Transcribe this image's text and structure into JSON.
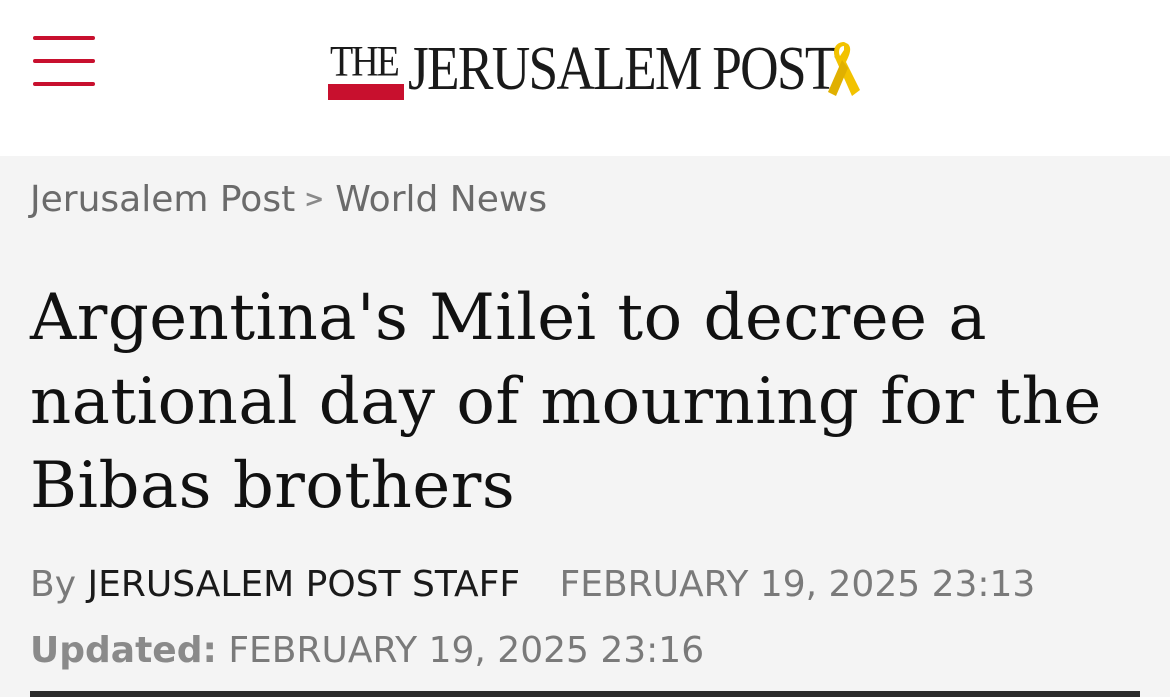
{
  "header": {
    "menu_icon": "hamburger-menu-icon",
    "logo": {
      "the": "THE",
      "name": "JERUSALEM POST",
      "ribbon_icon": "yellow-ribbon-icon"
    },
    "colors": {
      "brand_red": "#c8102e",
      "ribbon_yellow": "#f2c200"
    }
  },
  "breadcrumb": {
    "home": "Jerusalem Post",
    "separator": ">",
    "section": "World News"
  },
  "article": {
    "headline": "Argentina's Milei to decree a national day of mourning for the Bibas brothers",
    "byline_prefix": "By",
    "author": "JERUSALEM POST STAFF",
    "published": "FEBRUARY 19, 2025 23:13",
    "updated_label": "Updated:",
    "updated": "FEBRUARY 19, 2025 23:16"
  }
}
